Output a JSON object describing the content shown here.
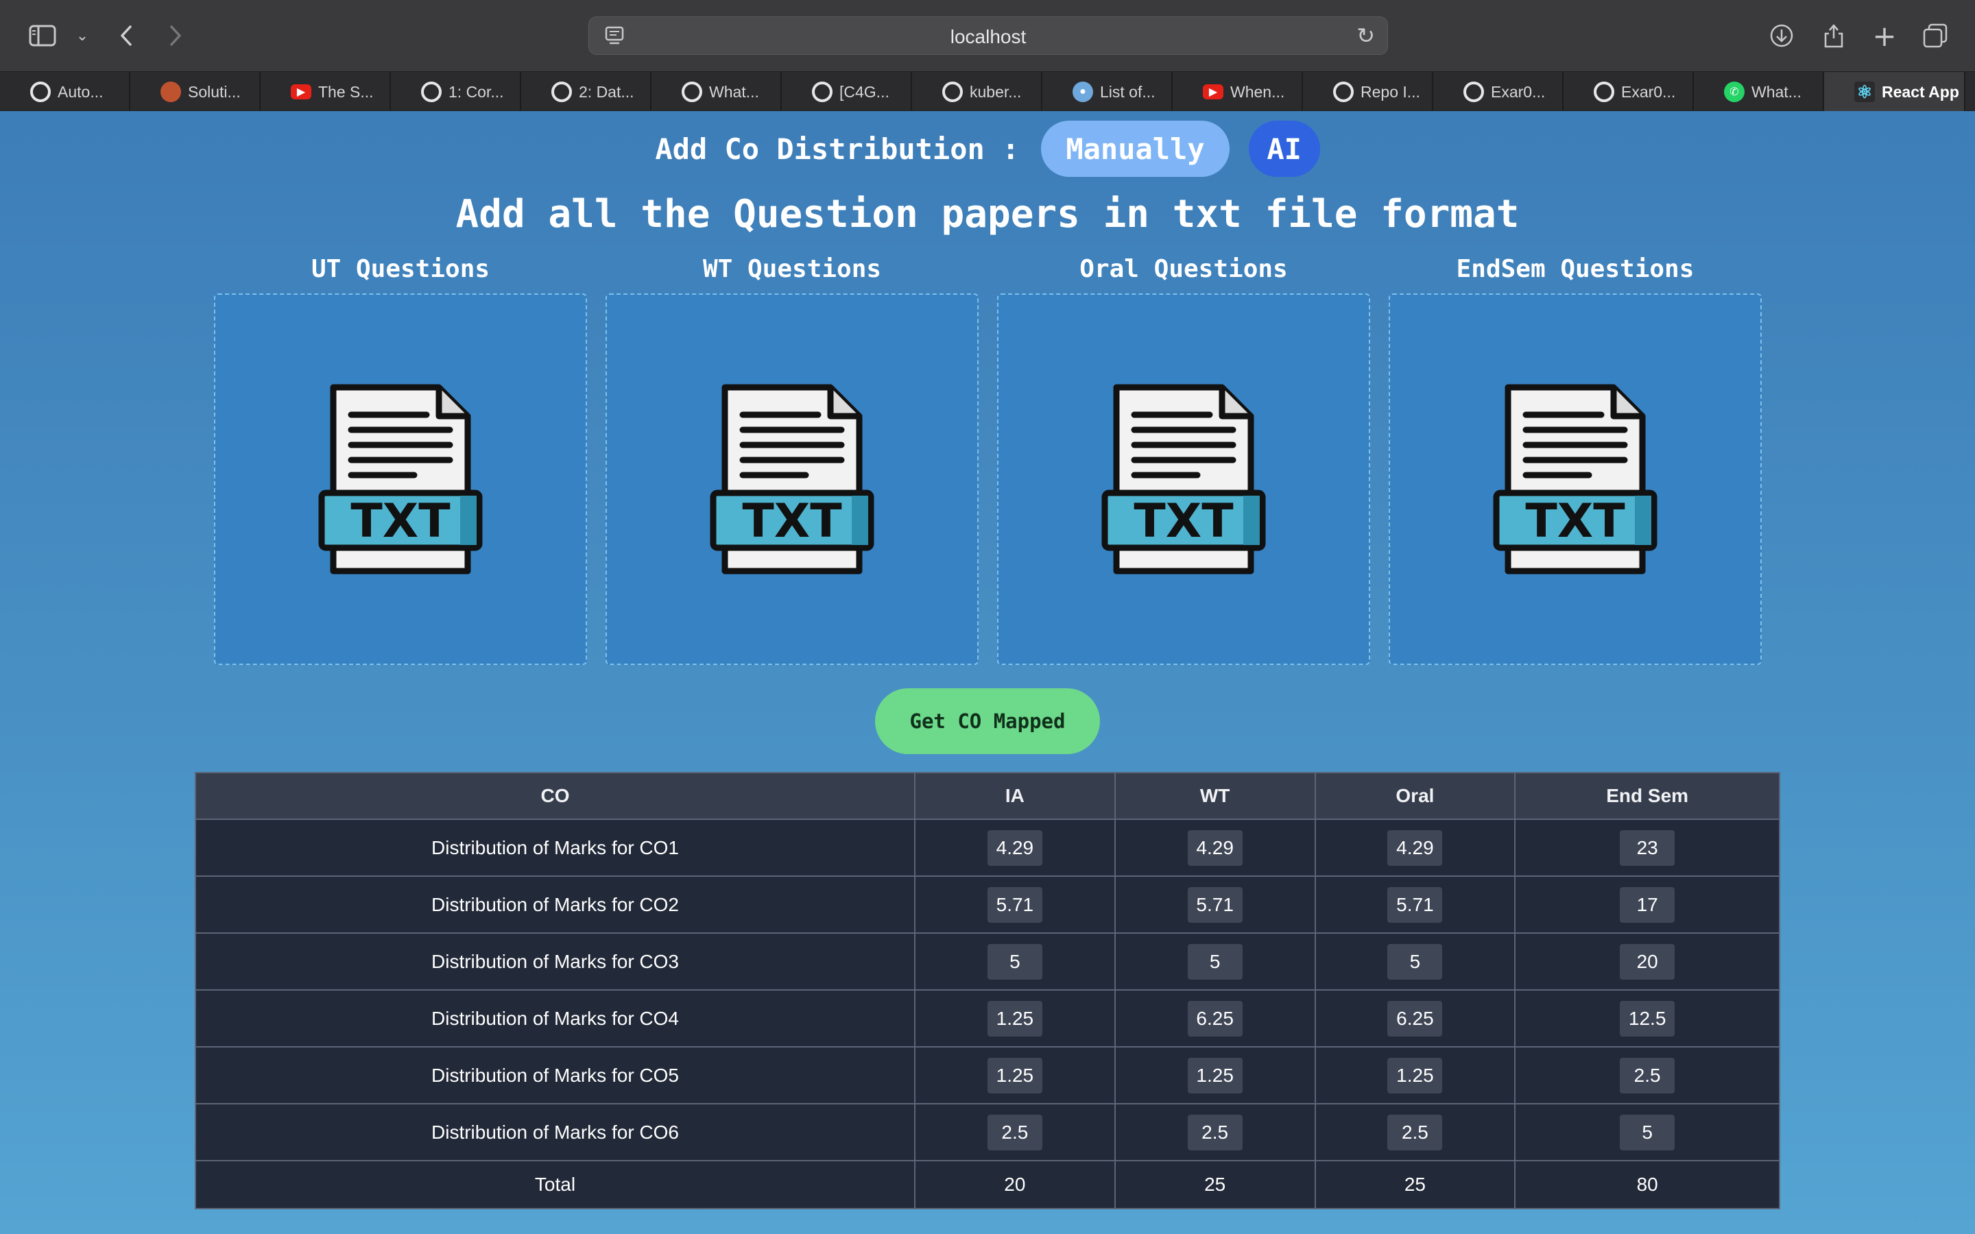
{
  "browser": {
    "url": "localhost",
    "tabs": [
      {
        "label": "Auto...",
        "icon": "github-icon",
        "color": "#e6e6e6"
      },
      {
        "label": "Soluti...",
        "icon": "app-icon",
        "color": "#c0532f"
      },
      {
        "label": "The S...",
        "icon": "youtube-icon",
        "color": "#e62117"
      },
      {
        "label": "1: Cor...",
        "icon": "github-icon",
        "color": "#e6e6e6"
      },
      {
        "label": "2: Dat...",
        "icon": "github-icon",
        "color": "#e6e6e6"
      },
      {
        "label": "What...",
        "icon": "github-icon",
        "color": "#e6e6e6"
      },
      {
        "label": "[C4G...",
        "icon": "github-icon",
        "color": "#e6e6e6"
      },
      {
        "label": "kuber...",
        "icon": "github-icon",
        "color": "#e6e6e6"
      },
      {
        "label": "List of...",
        "icon": "reddit-icon",
        "color": "#6fa8dc"
      },
      {
        "label": "When...",
        "icon": "youtube-icon",
        "color": "#e62117"
      },
      {
        "label": "Repo I...",
        "icon": "github-icon",
        "color": "#e6e6e6"
      },
      {
        "label": "Exar0...",
        "icon": "github-icon",
        "color": "#e6e6e6"
      },
      {
        "label": "Exar0...",
        "icon": "github-icon",
        "color": "#e6e6e6"
      },
      {
        "label": "What...",
        "icon": "whatsapp-icon",
        "color": "#25d366"
      },
      {
        "label": "React App",
        "icon": "react-icon",
        "color": "#61dafb",
        "active": true
      }
    ]
  },
  "mode": {
    "label": "Add Co Distribution :",
    "manual": "Manually",
    "ai": "AI"
  },
  "title": "Add all the Question papers in txt file format",
  "uploads": [
    {
      "title": "UT Questions",
      "icon_text": "TXT"
    },
    {
      "title": "WT Questions",
      "icon_text": "TXT"
    },
    {
      "title": "Oral Questions",
      "icon_text": "TXT"
    },
    {
      "title": "EndSem Questions",
      "icon_text": "TXT"
    }
  ],
  "map_button": "Get CO Mapped",
  "table": {
    "headers": [
      "CO",
      "IA",
      "WT",
      "Oral",
      "End Sem"
    ],
    "rows": [
      {
        "label": "Distribution of Marks for CO1",
        "values": [
          "4.29",
          "4.29",
          "4.29",
          "23"
        ]
      },
      {
        "label": "Distribution of Marks for CO2",
        "values": [
          "5.71",
          "5.71",
          "5.71",
          "17"
        ]
      },
      {
        "label": "Distribution of Marks for CO3",
        "values": [
          "5",
          "5",
          "5",
          "20"
        ]
      },
      {
        "label": "Distribution of Marks for CO4",
        "values": [
          "1.25",
          "6.25",
          "6.25",
          "12.5"
        ]
      },
      {
        "label": "Distribution of Marks for CO5",
        "values": [
          "1.25",
          "1.25",
          "1.25",
          "2.5"
        ]
      },
      {
        "label": "Distribution of Marks for CO6",
        "values": [
          "2.5",
          "2.5",
          "2.5",
          "5"
        ]
      }
    ],
    "total": {
      "label": "Total",
      "values": [
        "20",
        "25",
        "25",
        "80"
      ]
    }
  }
}
